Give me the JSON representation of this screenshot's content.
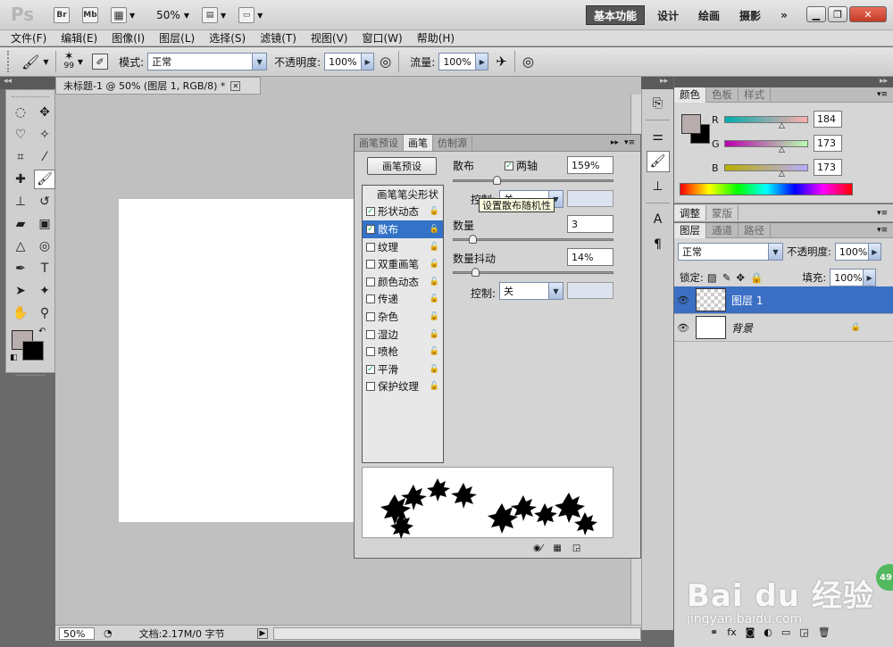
{
  "app": {
    "logo": "Ps",
    "bridge": "Br",
    "minibridge": "Mb",
    "zoom": "50%"
  },
  "workspaces": [
    {
      "label": "基本功能",
      "active": true
    },
    {
      "label": "设计",
      "active": false
    },
    {
      "label": "绘画",
      "active": false
    },
    {
      "label": "摄影",
      "active": false
    }
  ],
  "more": "»",
  "menu": [
    "文件(F)",
    "编辑(E)",
    "图像(I)",
    "图层(L)",
    "选择(S)",
    "滤镜(T)",
    "视图(V)",
    "窗口(W)",
    "帮助(H)"
  ],
  "options": {
    "brush_size": "99",
    "mode_label": "模式:",
    "mode_value": "正常",
    "opacity_label": "不透明度:",
    "opacity_value": "100%",
    "flow_label": "流量:",
    "flow_value": "100%"
  },
  "document": {
    "tab_title": "未标题-1 @ 50% (图层 1, RGB/8) *",
    "zoom": "50%",
    "info": "文档:2.17M/0 字节"
  },
  "brush_panel": {
    "tabs": [
      {
        "label": "画笔预设",
        "active": false
      },
      {
        "label": "画笔",
        "active": true
      },
      {
        "label": "仿制源",
        "active": false
      }
    ],
    "preset_button": "画笔预设",
    "list_header": "画笔笔尖形状",
    "items": [
      {
        "label": "形状动态",
        "checked": true,
        "selected": false
      },
      {
        "label": "散布",
        "checked": true,
        "selected": true
      },
      {
        "label": "纹理",
        "checked": false,
        "selected": false
      },
      {
        "label": "双重画笔",
        "checked": false,
        "selected": false
      },
      {
        "label": "颜色动态",
        "checked": false,
        "selected": false
      },
      {
        "label": "传递",
        "checked": false,
        "selected": false
      },
      {
        "label": "杂色",
        "checked": false,
        "selected": false
      },
      {
        "label": "湿边",
        "checked": false,
        "selected": false
      },
      {
        "label": "喷枪",
        "checked": false,
        "selected": false
      },
      {
        "label": "平滑",
        "checked": true,
        "selected": false
      },
      {
        "label": "保护纹理",
        "checked": false,
        "selected": false
      }
    ],
    "scatter_label": "散布",
    "both_axes_label": "两轴",
    "scatter_value": "159%",
    "scatter_level": 0.27,
    "control_label": "控制:",
    "control1_value": "关",
    "tooltip": "设置散布随机性",
    "count_label": "数量",
    "count_value": "3",
    "count_level": 0.12,
    "count_jitter_label": "数量抖动",
    "count_jitter_value": "14%",
    "count_jitter_level": 0.14,
    "control2_value": "关"
  },
  "color_panel": {
    "tabs": [
      {
        "label": "颜色",
        "active": true
      },
      {
        "label": "色板",
        "active": false
      },
      {
        "label": "样式",
        "active": false
      }
    ],
    "r_label": "R",
    "g_label": "G",
    "b_label": "B",
    "r": "184",
    "g": "173",
    "b": "173",
    "fg_color": "#b8adad",
    "bg_color": "#000000"
  },
  "adjust_tabs": [
    {
      "label": "调整",
      "active": true
    },
    {
      "label": "蒙版",
      "active": false
    }
  ],
  "layers_panel": {
    "tabs": [
      {
        "label": "图层",
        "active": true
      },
      {
        "label": "通道",
        "active": false
      },
      {
        "label": "路径",
        "active": false
      }
    ],
    "blend": "正常",
    "opacity_label": "不透明度:",
    "opacity": "100%",
    "lock_label": "锁定:",
    "fill_label": "填充:",
    "fill": "100%",
    "layers": [
      {
        "name": "图层 1",
        "selected": true
      },
      {
        "name": "背景",
        "selected": false
      }
    ]
  },
  "watermark": {
    "brand": "Bai du 经验",
    "url": "jingyan.baidu.com",
    "badge": "49"
  }
}
